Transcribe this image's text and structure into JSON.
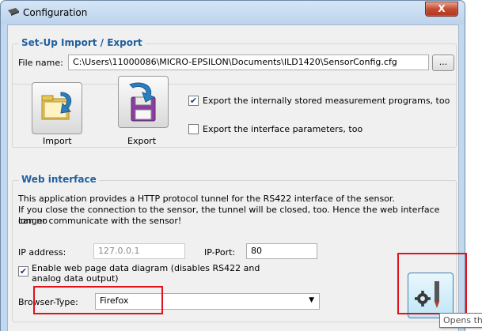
{
  "window": {
    "title": "Configuration",
    "close_label": "X"
  },
  "import_export": {
    "group_title": "Set-Up Import / Export",
    "file_name_label": "File name:",
    "file_name_value": "C:\\Users\\11000086\\MICRO-EPSILON\\Documents\\ILD1420\\SensorConfig.cfg",
    "browse_label": "...",
    "import_label": "Import",
    "export_label": "Export",
    "export_programs_label": "Export the internally stored measurement programs, too",
    "export_programs_checked": true,
    "export_interface_label": "Export the interface parameters, too",
    "export_interface_checked": false
  },
  "web_interface": {
    "group_title": "Web interface",
    "info_line1": "This application provides a HTTP protocol tunnel for the RS422 interface of the sensor.",
    "info_line2": "If you close the connection to the sensor, the tunnel will be closed, too. Hence the web interface can no",
    "info_line3": "longer communicate with the sensor!",
    "ip_address_label": "IP address:",
    "ip_address_value": "127.0.0.1",
    "ip_port_label": "IP-Port:",
    "ip_port_value": "80",
    "enable_diagram_label_line1": "Enable web page data diagram (disables RS422 and",
    "enable_diagram_label_line2": "analog data output)",
    "enable_diagram_checked": true,
    "browser_type_label": "Browser-Type:",
    "browser_type_value": "Firefox"
  },
  "tooltip": {
    "text": "Opens the ILD"
  },
  "colors": {
    "group_title": "#1f5f9e",
    "highlight_box": "#e0121b"
  },
  "icons": {
    "app": "sensor-icon",
    "import": "import-folder-icon",
    "export": "export-floppy-icon",
    "web": "gear-pen-icon"
  }
}
